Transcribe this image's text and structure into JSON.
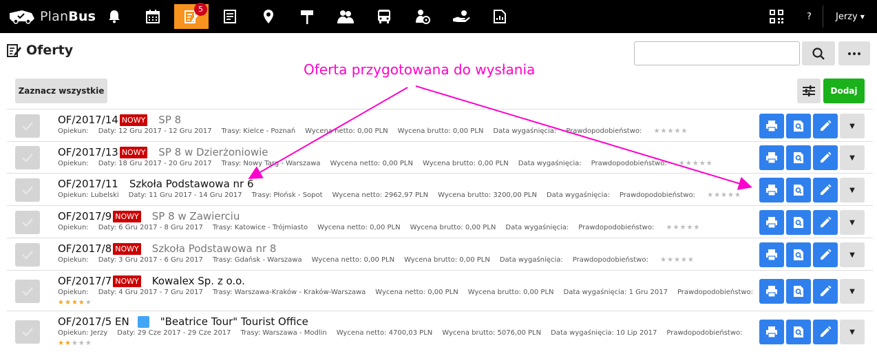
{
  "app": {
    "logo_plan": "Plan",
    "logo_bus": "Bus"
  },
  "nav": {
    "items": [
      {
        "name": "bell-icon"
      },
      {
        "name": "calendar-icon"
      },
      {
        "name": "offers-icon",
        "badge": "5"
      },
      {
        "name": "document-icon"
      },
      {
        "name": "map-pin-icon"
      },
      {
        "name": "signpost-icon"
      },
      {
        "name": "people-icon"
      },
      {
        "name": "bus-icon"
      },
      {
        "name": "driver-icon"
      },
      {
        "name": "hand-coin-icon"
      },
      {
        "name": "report-icon"
      }
    ],
    "help": "?",
    "user": "Jerzy"
  },
  "header": {
    "title": "Oferty",
    "search_placeholder": "",
    "select_all": "Zaznacz wszystkie",
    "add": "Dodaj"
  },
  "annotation": "Oferta przygotowana do wysłania",
  "offers": [
    {
      "code": "OF/2017/14",
      "new": "NOWY",
      "name": "SP 8",
      "style": "gray",
      "opiekun": "Opiekun:",
      "daty": "Daty: 12 Gru 2017 - 12 Gru 2017",
      "trasy": "Trasy: Kielce - Poznań",
      "netto": "Wycena netto: 0,00 PLN",
      "brutto": "Wycena brutto: 0,00 PLN",
      "wyg": "Data wygaśnięcia:",
      "prawd": "Prawdopodobieństwo:",
      "stars": 0,
      "stars_inline": true
    },
    {
      "code": "OF/2017/13",
      "new": "NOWY",
      "name": "SP 8 w Dzierżoniowie",
      "style": "gray",
      "opiekun": "Opiekun:",
      "daty": "Daty: 18 Gru 2017 - 20 Gru 2017",
      "trasy": "Trasy: Nowy Targ - Warszawa",
      "netto": "Wycena netto: 0,00 PLN",
      "brutto": "Wycena brutto: 0,00 PLN",
      "wyg": "Data wygaśnięcia:",
      "prawd": "Prawdopodobieństwo:",
      "stars": 0,
      "stars_inline": true
    },
    {
      "code": "OF/2017/11",
      "new": "",
      "name": "Szkoła Podstawowa nr 6",
      "style": "dark",
      "opiekun": "Opiekun: Lubelski",
      "daty": "Daty: 11 Gru 2017 - 14 Gru 2017",
      "trasy": "Trasy: Płońsk - Sopot",
      "netto": "Wycena netto: 2962,97 PLN",
      "brutto": "Wycena brutto: 3200,00 PLN",
      "wyg": "Data wygaśnięcia:",
      "prawd": "Prawdopodobieństwo:",
      "stars": 0,
      "stars_inline": true
    },
    {
      "code": "OF/2017/9",
      "new": "NOWY",
      "name": "SP 8 w Zawierciu",
      "style": "gray",
      "opiekun": "Opiekun:",
      "daty": "Daty: 6 Gru 2017 - 8 Gru 2017",
      "trasy": "Trasy: Katowice - Trójmiasto",
      "netto": "Wycena netto: 0,00 PLN",
      "brutto": "Wycena brutto: 0,00 PLN",
      "wyg": "Data wygaśnięcia:",
      "prawd": "Prawdopodobieństwo:",
      "stars": 0,
      "stars_inline": true
    },
    {
      "code": "OF/2017/8",
      "new": "NOWY",
      "name": "Szkoła Podstawowa nr 8",
      "style": "gray",
      "opiekun": "Opiekun:",
      "daty": "Daty: 3 Gru 2017 - 6 Gru 2017",
      "trasy": "Trasy: Gdańsk - Warszawa",
      "netto": "Wycena netto: 0,00 PLN",
      "brutto": "Wycena brutto: 0,00 PLN",
      "wyg": "Data wygaśnięcia:",
      "prawd": "Prawdopodobieństwo:",
      "stars": 0,
      "stars_inline": true
    },
    {
      "code": "OF/2017/7",
      "new": "NOWY",
      "name": "Kowalex Sp. z o.o.",
      "style": "dark",
      "opiekun": "Opiekun:",
      "daty": "Daty: 4 Gru 2017 - 7 Gru 2017",
      "trasy": "Trasy: Warszawa-Kraków - Kraków-Warszawa",
      "netto": "Wycena netto: 0,00 PLN",
      "brutto": "Wycena brutto: 0,00 PLN",
      "wyg": "Data wygaśnięcia: 1 Gru 2017",
      "prawd": "Prawdopodobieństwo:",
      "stars": 4,
      "stars_inline": false
    },
    {
      "code": "OF/2017/5 EN",
      "new": "",
      "square": true,
      "name": "\"Beatrice Tour\" Tourist Office",
      "style": "dark",
      "opiekun": "Opiekun: Jerzy",
      "daty": "Daty: 29 Cze 2017 - 29 Cze 2017",
      "trasy": "Trasy: Warszawa - Modlin",
      "netto": "Wycena netto: 4700,03 PLN",
      "brutto": "Wycena brutto: 5076,00 PLN",
      "wyg": "Data wygaśnięcia: 10 Lip 2017",
      "prawd": "Prawdopodobieństwo:",
      "stars": 2,
      "stars_inline": false
    }
  ],
  "colors": {
    "accent": "#f7931e",
    "primary": "#2f80ed",
    "success": "#1ab11a",
    "new_badge": "#cc0000",
    "annotation": "#ff00cc"
  }
}
